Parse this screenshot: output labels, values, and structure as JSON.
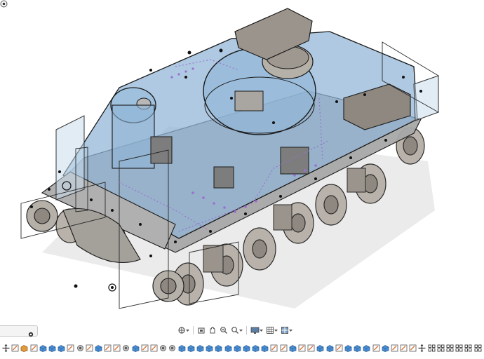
{
  "viewport": {
    "model_name": "tank-assembly",
    "colors": {
      "body_blue": "#8fb4d6",
      "hull_gray": "#a9a9a9",
      "edge_dark": "#1a1a1a",
      "sketch_purple": "#9b6fd1",
      "timeline_blue": "#4a90d9",
      "timeline_orange": "#e39a3b"
    }
  },
  "navigation_toolbar": {
    "tools": [
      {
        "name": "orbit-icon",
        "has_dropdown": true
      },
      {
        "name": "look-at-icon",
        "has_dropdown": false
      },
      {
        "name": "pan-icon",
        "has_dropdown": false
      },
      {
        "name": "zoom-icon",
        "has_dropdown": false
      },
      {
        "name": "fit-icon",
        "has_dropdown": true
      },
      {
        "name": "display-settings-icon",
        "has_dropdown": true
      },
      {
        "name": "grid-settings-icon",
        "has_dropdown": true
      },
      {
        "name": "viewports-icon",
        "has_dropdown": true
      }
    ]
  },
  "timeline": {
    "items": [
      "move",
      "sketch",
      "body",
      "sketch",
      "extrude",
      "extrude",
      "extrude",
      "sketch",
      "joint",
      "sketch",
      "extrude",
      "sketch",
      "sketch",
      "joint",
      "extrude",
      "sketch",
      "sketch",
      "joint",
      "joint",
      "extrude",
      "extrude",
      "extrude",
      "extrude",
      "extrude",
      "extrude",
      "extrude",
      "extrude",
      "extrude",
      "extrude",
      "sketch",
      "sketch",
      "extrude",
      "sketch",
      "sketch",
      "extrude",
      "extrude",
      "sketch",
      "extrude",
      "extrude",
      "extrude",
      "sketch",
      "extrude",
      "sketch",
      "sketch",
      "sketch",
      "move",
      "pattern",
      "pattern",
      "pattern",
      "pattern",
      "pattern",
      "pattern"
    ]
  }
}
